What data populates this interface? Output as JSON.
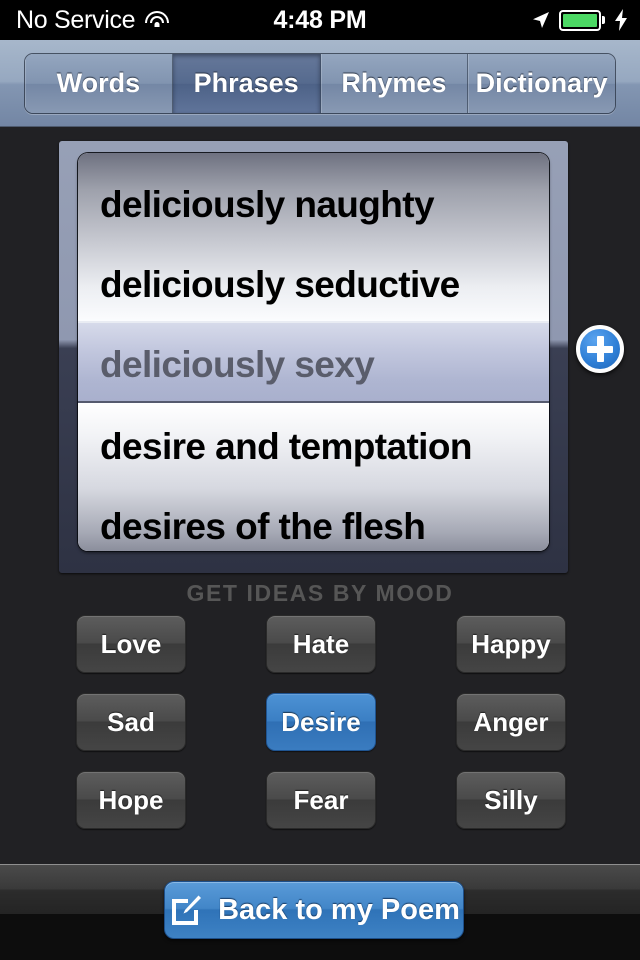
{
  "status_bar": {
    "carrier": "No Service",
    "wifi_icon": "wifi-icon",
    "time": "4:48 PM",
    "location_icon": "location-arrow-icon",
    "battery_icon": "battery-icon",
    "battery_color": "#4cd964",
    "charging_icon": "lightning-bolt-icon"
  },
  "segmented_control": {
    "selected": "Phrases",
    "tabs": [
      {
        "label": "Words",
        "selected": false
      },
      {
        "label": "Phrases",
        "selected": true
      },
      {
        "label": "Rhymes",
        "selected": false
      },
      {
        "label": "Dictionary",
        "selected": false
      }
    ]
  },
  "picker": {
    "selected_index": 2,
    "rows": [
      {
        "text": "deliciously naughty"
      },
      {
        "text": "deliciously seductive"
      },
      {
        "text": "deliciously sexy"
      },
      {
        "text": "desire and temptation"
      },
      {
        "text": "desires of the flesh"
      }
    ]
  },
  "add_button": {
    "icon": "plus-icon",
    "color": "#2f7fd6"
  },
  "mood_section": {
    "title": "GET IDEAS BY MOOD",
    "selected": "Desire",
    "selected_color": "#3b7fc4",
    "buttons": [
      {
        "label": "Love",
        "selected": false
      },
      {
        "label": "Hate",
        "selected": false
      },
      {
        "label": "Happy",
        "selected": false
      },
      {
        "label": "Sad",
        "selected": false
      },
      {
        "label": "Desire",
        "selected": true
      },
      {
        "label": "Anger",
        "selected": false
      },
      {
        "label": "Hope",
        "selected": false
      },
      {
        "label": "Fear",
        "selected": false
      },
      {
        "label": "Silly",
        "selected": false
      }
    ]
  },
  "toolbar": {
    "back_label": "Back to my Poem",
    "back_icon": "compose-icon",
    "back_color": "#4286c8"
  }
}
